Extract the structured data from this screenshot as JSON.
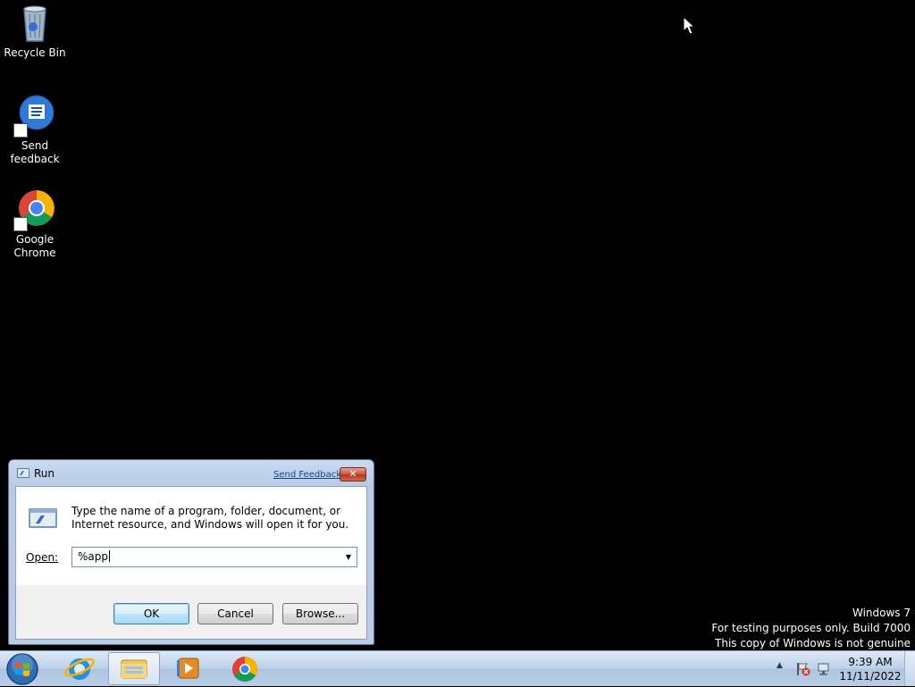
{
  "desktop": {
    "icons": [
      {
        "label": "Recycle Bin"
      },
      {
        "label": "Send\nfeedback"
      },
      {
        "label": "Google\nChrome"
      }
    ]
  },
  "watermark": {
    "line1": "Windows  7",
    "line2": "For testing purposes only. Build 7000",
    "line3": "This copy of Windows is not genuine"
  },
  "run_dialog": {
    "title": "Run",
    "send_feedback": "Send Feedback",
    "close": "✕",
    "description": "Type the name of a program, folder, document, or Internet resource, and Windows will open it for you.",
    "open_label": "Open:",
    "open_value": "%app",
    "ok": "OK",
    "cancel": "Cancel",
    "browse": "Browse..."
  },
  "taskbar": {
    "pinned": [
      "internet-explorer",
      "windows-explorer",
      "media-player",
      "google-chrome"
    ],
    "clock_time": "9:39 AM",
    "clock_date": "11/11/2022"
  }
}
